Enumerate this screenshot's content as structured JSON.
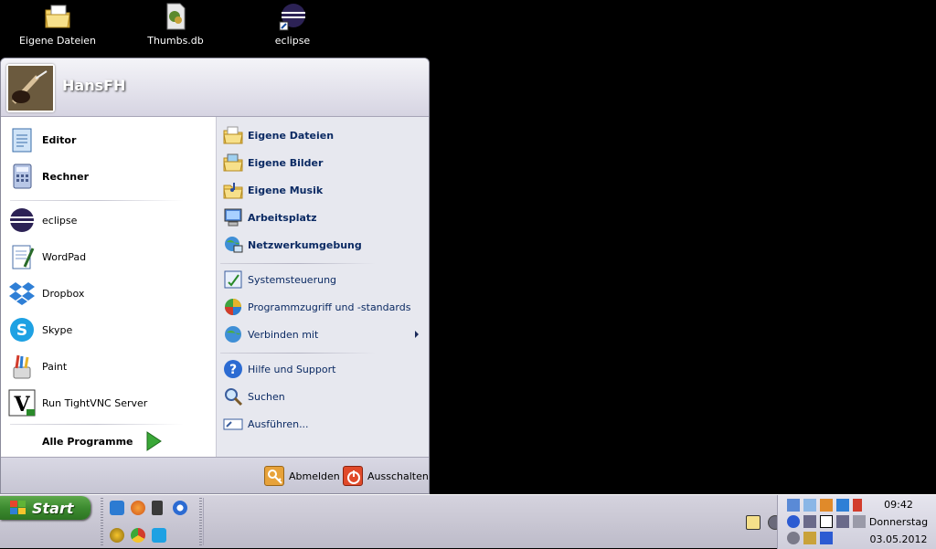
{
  "desktop": {
    "icons": [
      {
        "label": "Eigene Dateien",
        "icon": "folder-documents-icon"
      },
      {
        "label": "Thumbs.db",
        "icon": "file-db-icon"
      },
      {
        "label": "eclipse",
        "icon": "eclipse-shortcut-icon"
      }
    ]
  },
  "start_menu": {
    "username": "HansFH",
    "pinned": [
      {
        "label": "Editor",
        "icon": "notepad-icon"
      },
      {
        "label": "Rechner",
        "icon": "calculator-icon"
      }
    ],
    "recent": [
      {
        "label": "eclipse",
        "icon": "eclipse-icon"
      },
      {
        "label": "WordPad",
        "icon": "wordpad-icon"
      },
      {
        "label": "Dropbox",
        "icon": "dropbox-icon"
      },
      {
        "label": "Skype",
        "icon": "skype-icon"
      },
      {
        "label": "Paint",
        "icon": "paint-icon"
      },
      {
        "label": "Run TightVNC Server",
        "icon": "tightvnc-icon"
      }
    ],
    "all_programs": "Alle Programme",
    "places": [
      {
        "label": "Eigene Dateien",
        "icon": "my-documents-icon"
      },
      {
        "label": "Eigene Bilder",
        "icon": "my-pictures-icon"
      },
      {
        "label": "Eigene Musik",
        "icon": "my-music-icon"
      },
      {
        "label": "Arbeitsplatz",
        "icon": "my-computer-icon"
      },
      {
        "label": "Netzwerkumgebung",
        "icon": "network-icon"
      }
    ],
    "system": [
      {
        "label": "Systemsteuerung",
        "icon": "control-panel-icon"
      },
      {
        "label": "Programmzugriff und -standards",
        "icon": "program-defaults-icon"
      },
      {
        "label": "Verbinden mit",
        "icon": "connect-to-icon"
      }
    ],
    "help": [
      {
        "label": "Hilfe und Support",
        "icon": "help-icon"
      },
      {
        "label": "Suchen",
        "icon": "search-icon"
      },
      {
        "label": "Ausführen...",
        "icon": "run-icon"
      }
    ],
    "footer": {
      "logoff": "Abmelden",
      "shutdown": "Ausschalten"
    }
  },
  "taskbar": {
    "start_label": "Start",
    "clock": {
      "time": "09:42",
      "day": "Donnerstag",
      "date": "03.05.2012"
    }
  },
  "colors": {
    "start_green": "#3c8b30",
    "menu_blue_text": "#0b2a63",
    "desktop": "#000000"
  }
}
